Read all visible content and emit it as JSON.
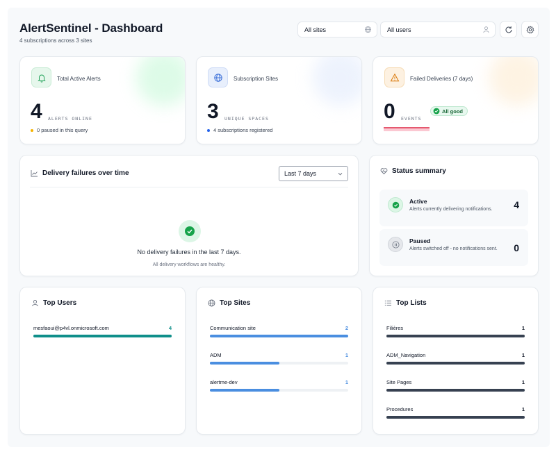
{
  "header": {
    "title": "AlertSentinel - Dashboard",
    "subtitle": "4 subscriptions across 3 sites",
    "site_filter": "All sites",
    "user_filter": "All users",
    "site_filter_icon": "globe-icon",
    "user_filter_icon": "user-icon",
    "refresh_icon": "refresh-icon",
    "settings_icon": "gear-icon"
  },
  "stats": [
    {
      "label": "Total Active Alerts",
      "value": "4",
      "unit": "ALERTS ONLINE",
      "note": "0 paused in this query",
      "icon": "bell-icon",
      "accent": "#22c55e",
      "dot": "#f5b300"
    },
    {
      "label": "Subscription Sites",
      "value": "3",
      "unit": "UNIQUE SPACES",
      "note": "4 subscriptions registered",
      "icon": "globe-icon",
      "accent": "#3b82f6",
      "dot": "#2563eb"
    },
    {
      "label": "Failed Deliveries (7 days)",
      "value": "0",
      "unit": "EVENTS",
      "badge": "All good",
      "icon": "warning-icon",
      "accent": "#f59e0b"
    }
  ],
  "failures_chart": {
    "title": "Delivery failures over time",
    "range": "Last 7 days",
    "empty_title": "No delivery failures in the last 7 days.",
    "empty_subtitle": "All delivery workflows are healthy."
  },
  "status_summary": {
    "title": "Status summary",
    "items": [
      {
        "name": "Active",
        "description": "Alerts currently delivering notifications.",
        "count": "4"
      },
      {
        "name": "Paused",
        "description": "Alerts switched off - no notifications sent.",
        "count": "0"
      }
    ]
  },
  "top_users": {
    "title": "Top Users",
    "color": "#0f8f8a",
    "items": [
      {
        "label": "mesfaoui@p4vl.onmicrosoft.com",
        "count": "4",
        "fraction": 1.0
      }
    ]
  },
  "top_sites": {
    "title": "Top Sites",
    "color": "#4a8ee0",
    "items": [
      {
        "label": "Communication site",
        "count": "2",
        "fraction": 1.0
      },
      {
        "label": "ADM",
        "count": "1",
        "fraction": 0.5
      },
      {
        "label": "alertme-dev",
        "count": "1",
        "fraction": 0.5
      }
    ]
  },
  "top_lists": {
    "title": "Top Lists",
    "color": "#374151",
    "items": [
      {
        "label": "Filières",
        "count": "1",
        "fraction": 1.0
      },
      {
        "label": "ADM_Navigation",
        "count": "1",
        "fraction": 1.0
      },
      {
        "label": "Site Pages",
        "count": "1",
        "fraction": 1.0
      },
      {
        "label": "Procedures",
        "count": "1",
        "fraction": 1.0
      }
    ]
  }
}
